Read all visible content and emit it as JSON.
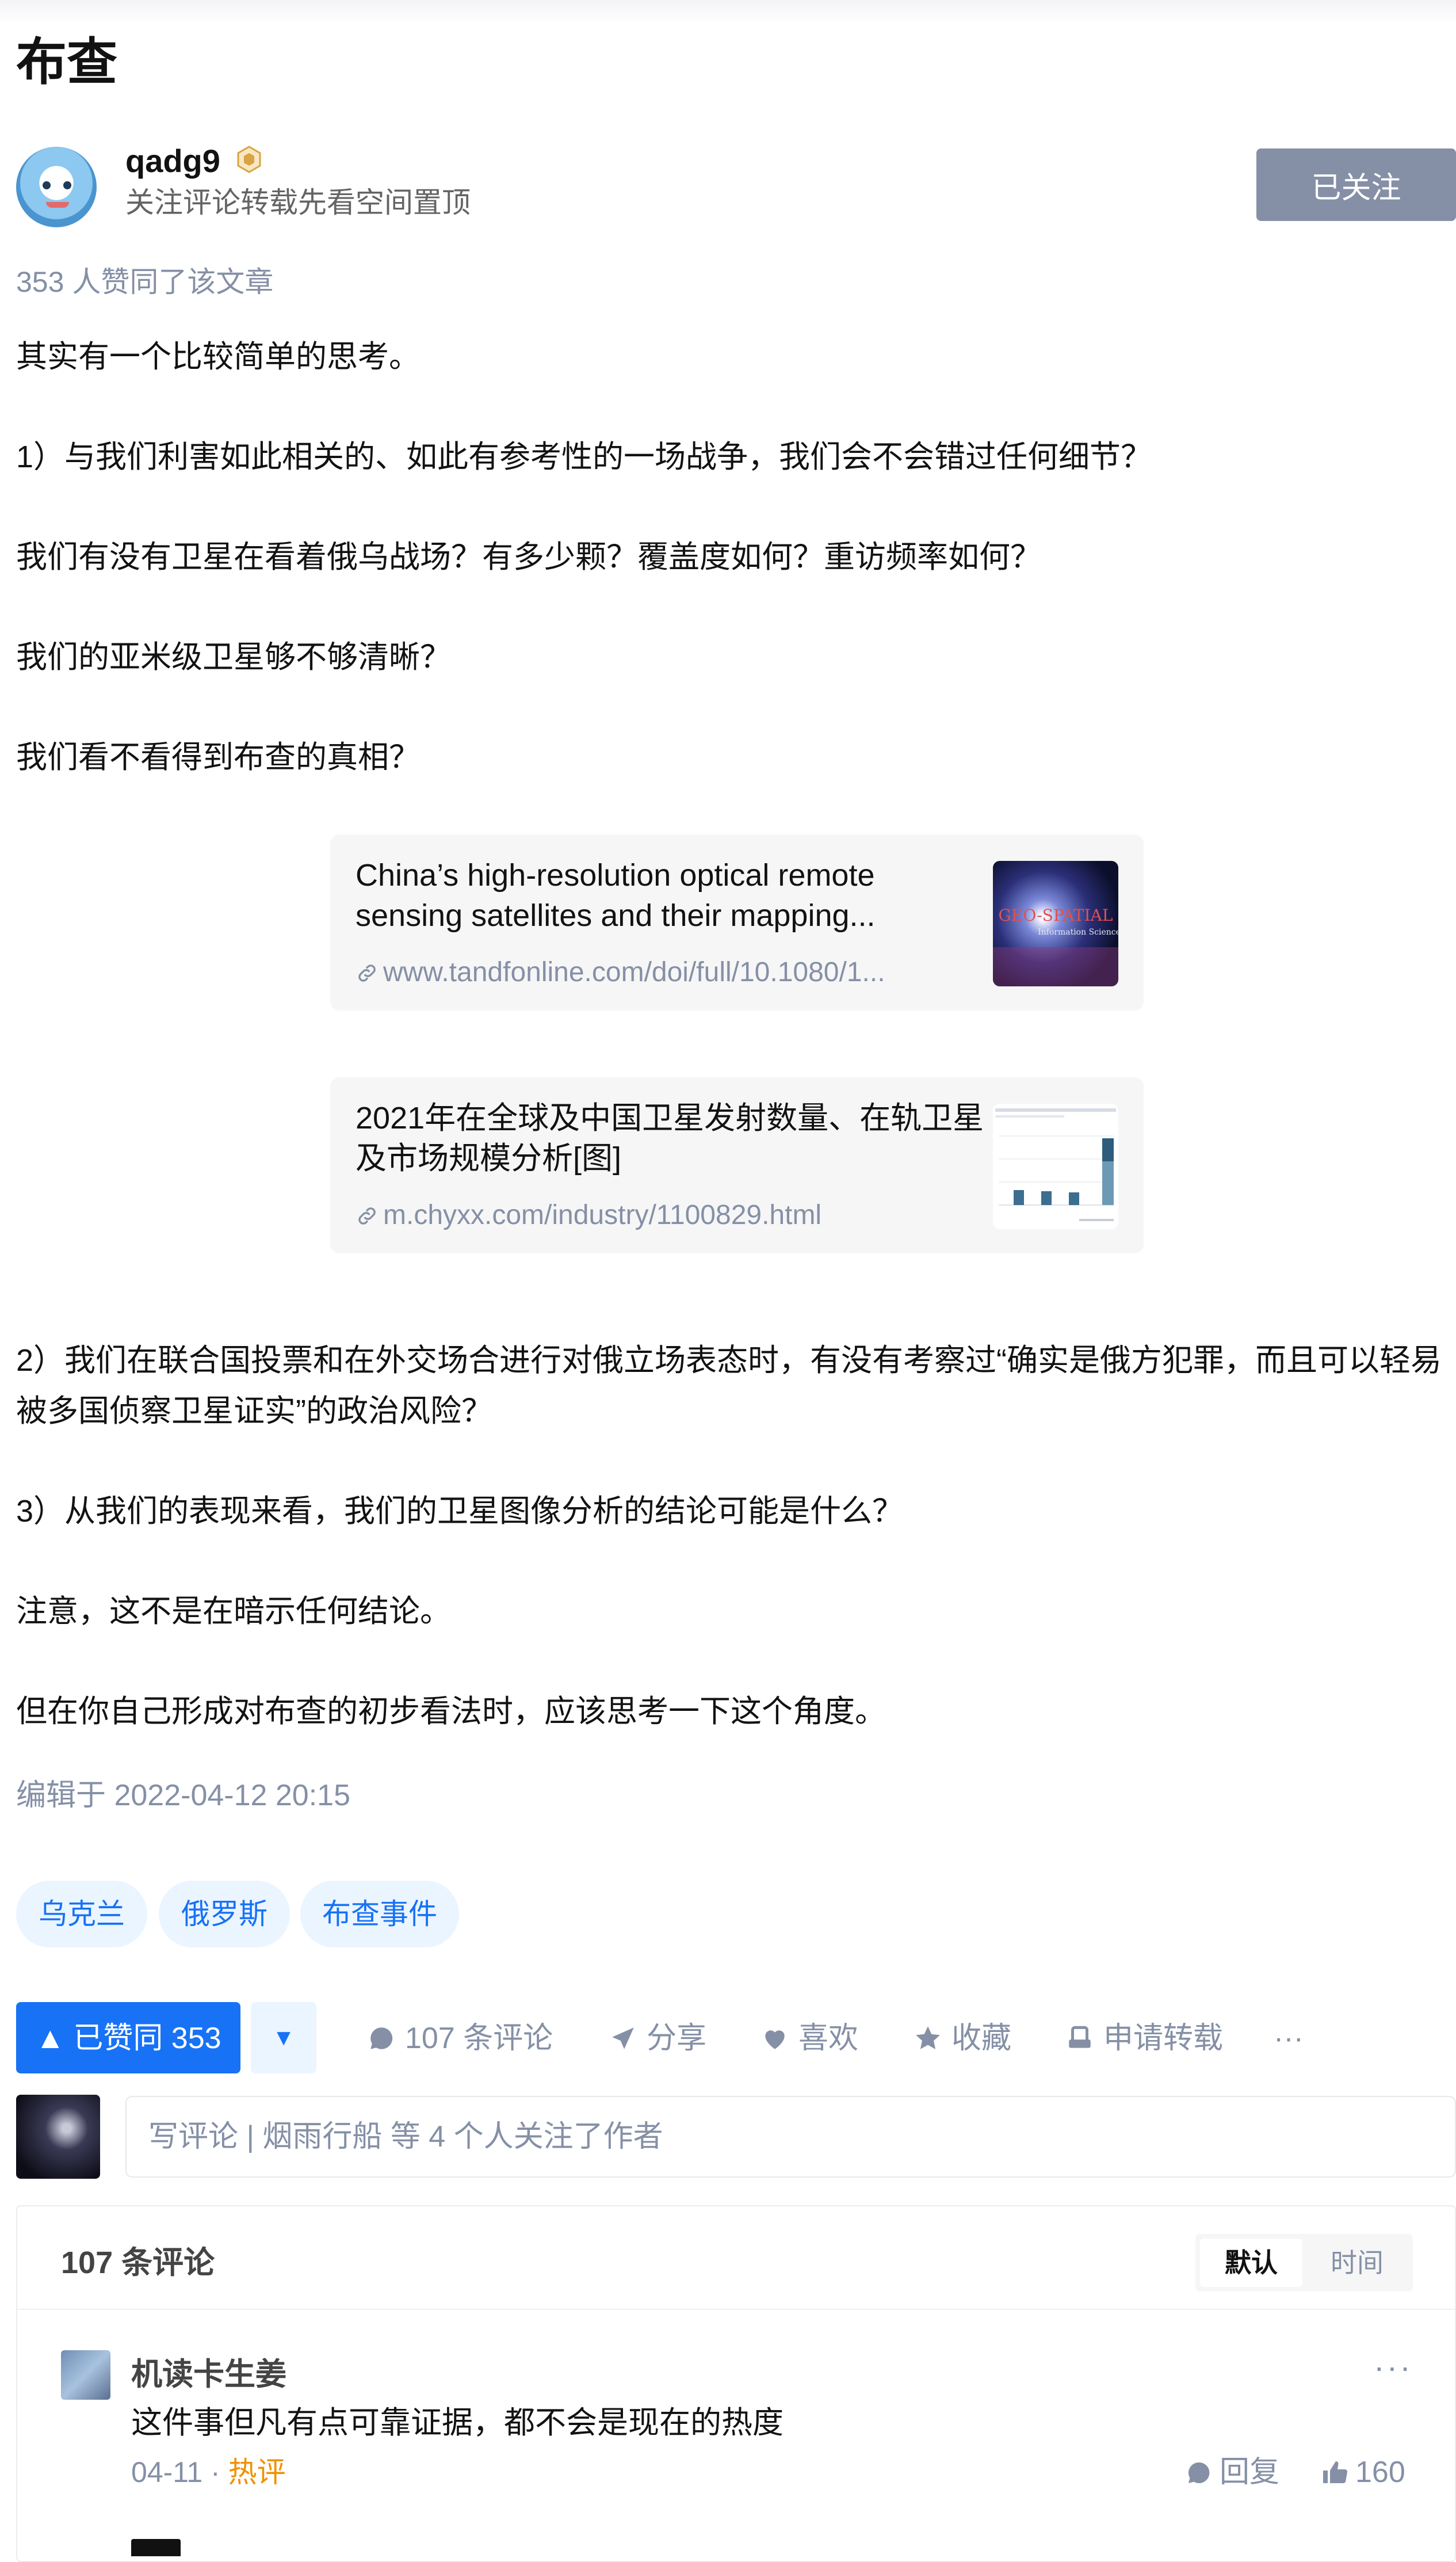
{
  "article": {
    "title": "布查",
    "author": {
      "name": "qadg9",
      "bio": "关注评论转载先看空间置顶",
      "follow_label": "已关注"
    },
    "likes_text": "353 人赞同了该文章",
    "paragraphs": [
      "其实有一个比较简单的思考。",
      "1）与我们利害如此相关的、如此有参考性的一场战争，我们会不会错过任何细节？",
      "我们有没有卫星在看着俄乌战场？有多少颗？覆盖度如何？重访频率如何？",
      "我们的亚米级卫星够不够清晰？",
      "我们看不看得到布查的真相？"
    ],
    "link_cards": [
      {
        "title": "China’s high-resolution optical remote sensing satellites and their mapping...",
        "url": "www.tandfonline.com/doi/full/10.1080/1...",
        "thumb_text": "GEO-SPATIAL",
        "thumb_sub": "Information Science"
      },
      {
        "title": "2021年在全球及中国卫星发射数量、在轨卫星及市场规模分析[图]",
        "url": "m.chyxx.com/industry/1100829.html"
      }
    ],
    "paragraphs_2": [
      "2）我们在联合国投票和在外交场合进行对俄立场表态时，有没有考察过“确实是俄方犯罪，而且可以轻易被多国侦察卫星证实”的政治风险？",
      "3）从我们的表现来看，我们的卫星图像分析的结论可能是什么？",
      "注意，这不是在暗示任何结论。",
      "但在你自己形成对布查的初步看法时，应该思考一下这个角度。"
    ],
    "edited": "编辑于 2022-04-12 20:15",
    "tags": [
      "乌克兰",
      "俄罗斯",
      "布查事件"
    ]
  },
  "actions": {
    "agree": "▲ 已赞同 353",
    "down": "▼",
    "comments": "107 条评论",
    "share": "分享",
    "like": "喜欢",
    "collect": "收藏",
    "repost": "申请转载",
    "more": "···"
  },
  "comment_input": {
    "placeholder": "写评论 | 烟雨行船 等 4 个人关注了作者"
  },
  "comments": {
    "count_label": "107 条评论",
    "sort_default": "默认",
    "sort_time": "时间",
    "items": [
      {
        "author": "机读卡生姜",
        "text": "这件事但凡有点可靠证据，都不会是现在的热度",
        "date": "04-11 · ",
        "hot": "热评",
        "reply_label": "回复",
        "likes": "160",
        "more": "···"
      }
    ]
  },
  "colors": {
    "accent": "#1772f6",
    "muted": "#8590a6",
    "followed_btn": "#8590a6",
    "hot": "#f09100"
  },
  "icons": [
    "badge-icon",
    "link-icon",
    "comment-icon",
    "share-icon",
    "heart-icon",
    "star-icon",
    "repost-icon",
    "thumb-up-icon"
  ]
}
